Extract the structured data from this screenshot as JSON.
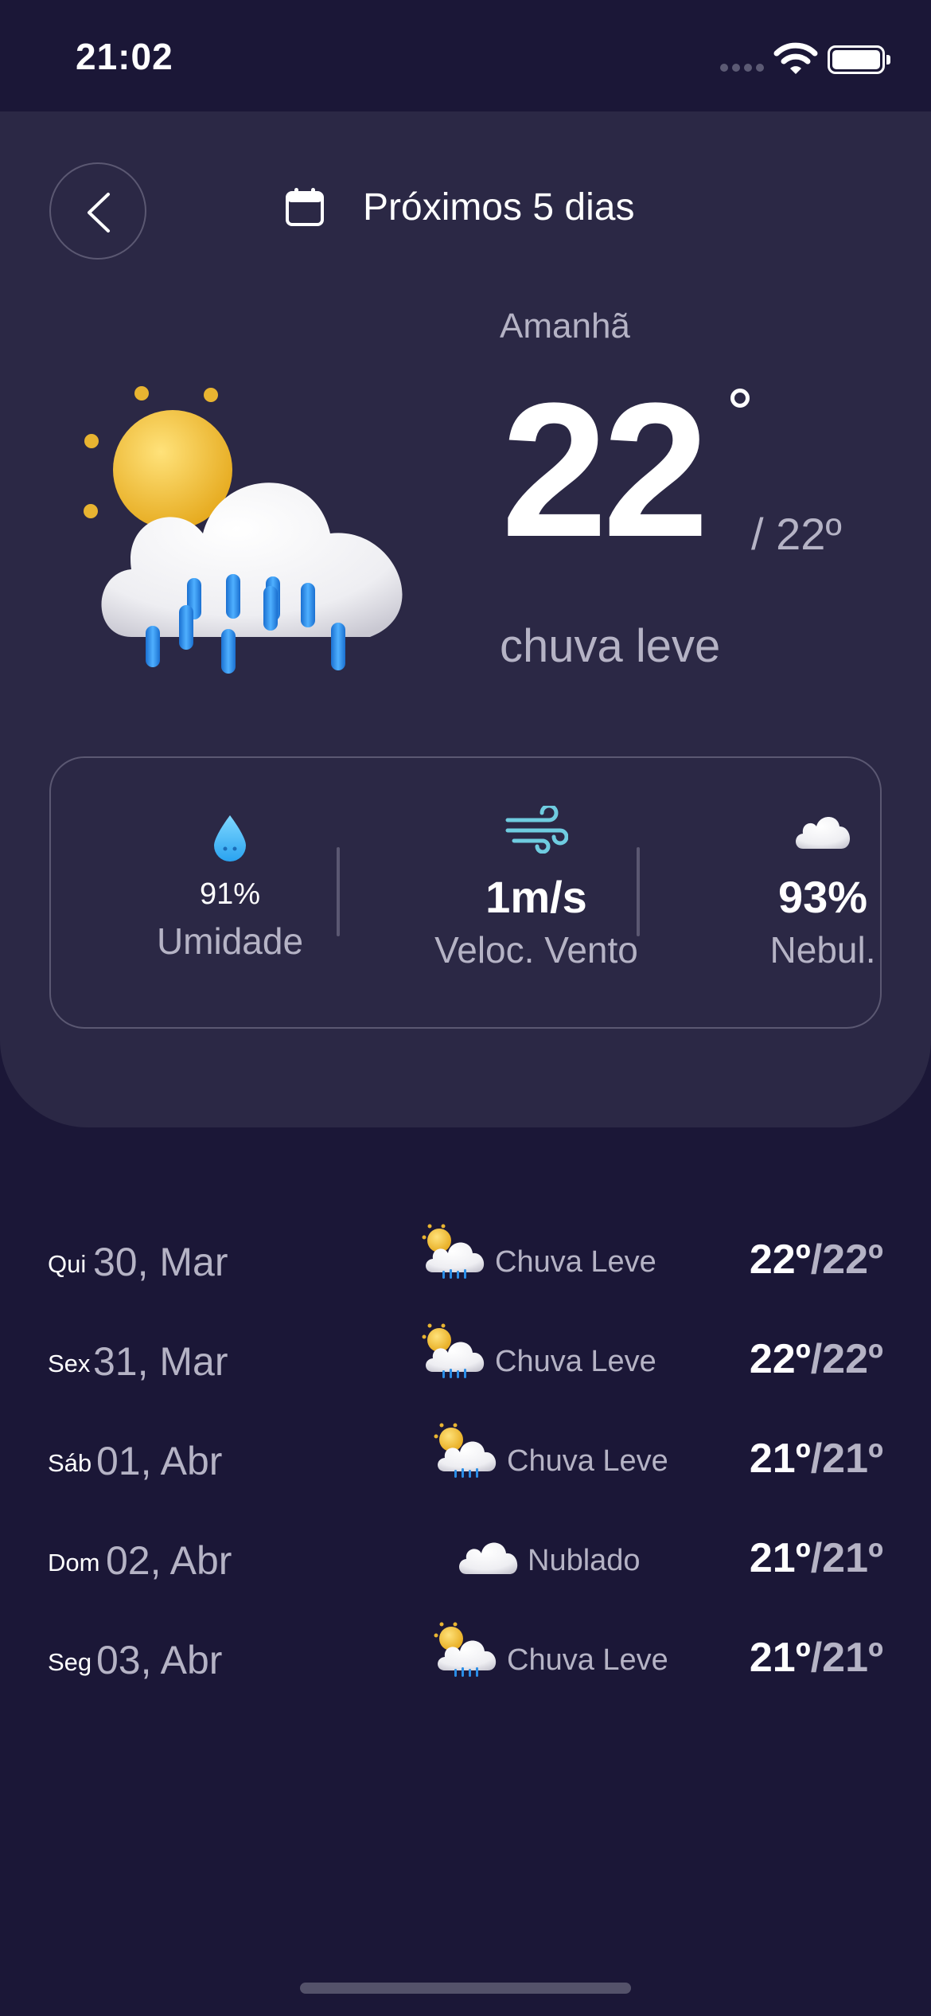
{
  "status_bar": {
    "time": "21:02"
  },
  "header": {
    "title": "Próximos 5 dias",
    "back_icon": "chevron-left-icon",
    "calendar_icon": "calendar-icon"
  },
  "current": {
    "day_label": "Amanhã",
    "temperature": "22",
    "range": "/ 22º",
    "condition": "chuva leve",
    "icon": "sun-cloud-rain-icon"
  },
  "stats": {
    "humidity": {
      "value": "91%",
      "label": "Umidade",
      "icon": "water-drop-icon"
    },
    "wind": {
      "value": "1m/s",
      "label": "Veloc. Vento",
      "icon": "wind-icon"
    },
    "cloudiness": {
      "value": "93%",
      "label": "Nebul.",
      "icon": "cloud-icon"
    }
  },
  "forecast": [
    {
      "weekday": "Qui",
      "date": "30, Mar",
      "condition": "Chuva Leve",
      "icon": "rain",
      "max": "22º",
      "sep": "/",
      "min": "22º"
    },
    {
      "weekday": "Sex",
      "date": "31, Mar",
      "condition": "Chuva Leve",
      "icon": "rain",
      "max": "22º",
      "sep": "/",
      "min": "22º"
    },
    {
      "weekday": "Sáb",
      "date": "01, Abr",
      "condition": "Chuva Leve",
      "icon": "rain",
      "max": "21º",
      "sep": "/",
      "min": "21º"
    },
    {
      "weekday": "Dom",
      "date": "02, Abr",
      "condition": "Nublado",
      "icon": "cloud",
      "max": "21º",
      "sep": "/",
      "min": "21º"
    },
    {
      "weekday": "Seg",
      "date": "03, Abr",
      "condition": "Chuva Leve",
      "icon": "rain",
      "max": "21º",
      "sep": "/",
      "min": "21º"
    }
  ],
  "colors": {
    "background": "#1b1737",
    "card": "#2b2845",
    "muted_text": "#b5b3c5",
    "border": "#5b5872",
    "rain_blue": "#2a8de6",
    "sun_yellow": "#f2c02c"
  }
}
